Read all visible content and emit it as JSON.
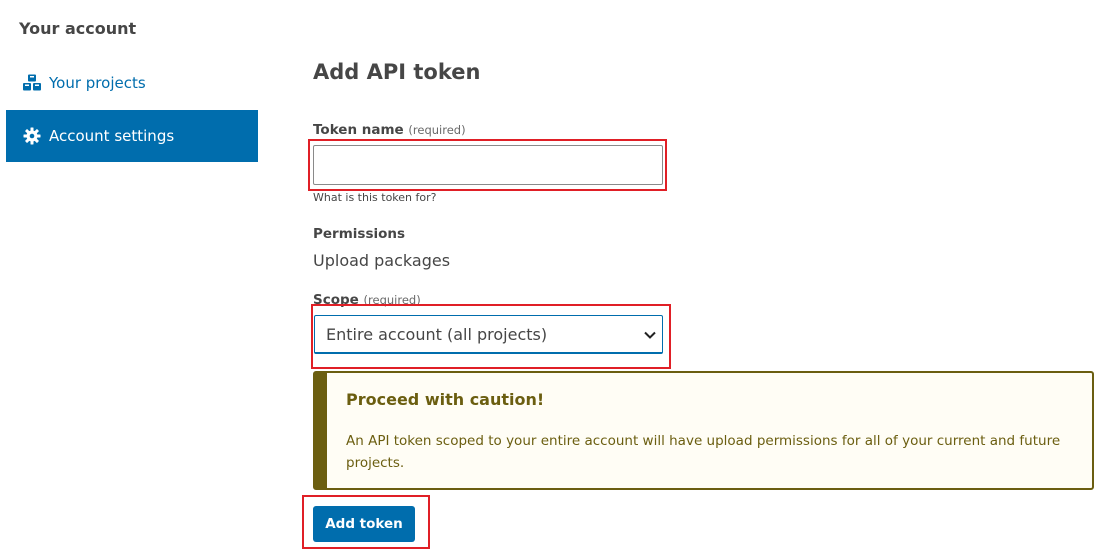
{
  "sidebar": {
    "heading": "Your account",
    "items": [
      {
        "label": "Your projects",
        "icon": "cubes-icon",
        "active": false
      },
      {
        "label": "Account settings",
        "icon": "gear-icon",
        "active": true
      }
    ]
  },
  "main": {
    "title": "Add API token",
    "token_name": {
      "label": "Token name",
      "required_note": "(required)",
      "value": "",
      "help": "What is this token for?"
    },
    "permissions": {
      "label": "Permissions",
      "value": "Upload packages"
    },
    "scope": {
      "label": "Scope",
      "required_note": "(required)",
      "selected": "Entire account (all projects)"
    },
    "caution": {
      "title": "Proceed with caution!",
      "body": "An API token scoped to your entire account will have upload permissions for all of your current and future projects."
    },
    "submit_label": "Add token"
  },
  "colors": {
    "primary": "#006dad",
    "caution": "#6b5e10",
    "annotation": "#e01f26"
  }
}
